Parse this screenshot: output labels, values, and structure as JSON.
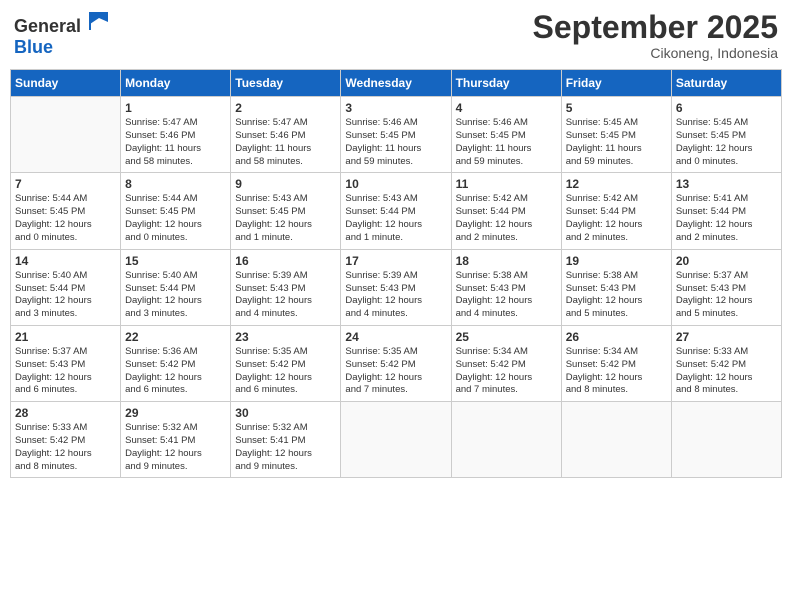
{
  "logo": {
    "general": "General",
    "blue": "Blue"
  },
  "header": {
    "month": "September 2025",
    "location": "Cikoneng, Indonesia"
  },
  "weekdays": [
    "Sunday",
    "Monday",
    "Tuesday",
    "Wednesday",
    "Thursday",
    "Friday",
    "Saturday"
  ],
  "weeks": [
    [
      {
        "day": "",
        "info": ""
      },
      {
        "day": "1",
        "info": "Sunrise: 5:47 AM\nSunset: 5:46 PM\nDaylight: 11 hours\nand 58 minutes."
      },
      {
        "day": "2",
        "info": "Sunrise: 5:47 AM\nSunset: 5:46 PM\nDaylight: 11 hours\nand 58 minutes."
      },
      {
        "day": "3",
        "info": "Sunrise: 5:46 AM\nSunset: 5:45 PM\nDaylight: 11 hours\nand 59 minutes."
      },
      {
        "day": "4",
        "info": "Sunrise: 5:46 AM\nSunset: 5:45 PM\nDaylight: 11 hours\nand 59 minutes."
      },
      {
        "day": "5",
        "info": "Sunrise: 5:45 AM\nSunset: 5:45 PM\nDaylight: 11 hours\nand 59 minutes."
      },
      {
        "day": "6",
        "info": "Sunrise: 5:45 AM\nSunset: 5:45 PM\nDaylight: 12 hours\nand 0 minutes."
      }
    ],
    [
      {
        "day": "7",
        "info": "Sunrise: 5:44 AM\nSunset: 5:45 PM\nDaylight: 12 hours\nand 0 minutes."
      },
      {
        "day": "8",
        "info": "Sunrise: 5:44 AM\nSunset: 5:45 PM\nDaylight: 12 hours\nand 0 minutes."
      },
      {
        "day": "9",
        "info": "Sunrise: 5:43 AM\nSunset: 5:45 PM\nDaylight: 12 hours\nand 1 minute."
      },
      {
        "day": "10",
        "info": "Sunrise: 5:43 AM\nSunset: 5:44 PM\nDaylight: 12 hours\nand 1 minute."
      },
      {
        "day": "11",
        "info": "Sunrise: 5:42 AM\nSunset: 5:44 PM\nDaylight: 12 hours\nand 2 minutes."
      },
      {
        "day": "12",
        "info": "Sunrise: 5:42 AM\nSunset: 5:44 PM\nDaylight: 12 hours\nand 2 minutes."
      },
      {
        "day": "13",
        "info": "Sunrise: 5:41 AM\nSunset: 5:44 PM\nDaylight: 12 hours\nand 2 minutes."
      }
    ],
    [
      {
        "day": "14",
        "info": "Sunrise: 5:40 AM\nSunset: 5:44 PM\nDaylight: 12 hours\nand 3 minutes."
      },
      {
        "day": "15",
        "info": "Sunrise: 5:40 AM\nSunset: 5:44 PM\nDaylight: 12 hours\nand 3 minutes."
      },
      {
        "day": "16",
        "info": "Sunrise: 5:39 AM\nSunset: 5:43 PM\nDaylight: 12 hours\nand 4 minutes."
      },
      {
        "day": "17",
        "info": "Sunrise: 5:39 AM\nSunset: 5:43 PM\nDaylight: 12 hours\nand 4 minutes."
      },
      {
        "day": "18",
        "info": "Sunrise: 5:38 AM\nSunset: 5:43 PM\nDaylight: 12 hours\nand 4 minutes."
      },
      {
        "day": "19",
        "info": "Sunrise: 5:38 AM\nSunset: 5:43 PM\nDaylight: 12 hours\nand 5 minutes."
      },
      {
        "day": "20",
        "info": "Sunrise: 5:37 AM\nSunset: 5:43 PM\nDaylight: 12 hours\nand 5 minutes."
      }
    ],
    [
      {
        "day": "21",
        "info": "Sunrise: 5:37 AM\nSunset: 5:43 PM\nDaylight: 12 hours\nand 6 minutes."
      },
      {
        "day": "22",
        "info": "Sunrise: 5:36 AM\nSunset: 5:42 PM\nDaylight: 12 hours\nand 6 minutes."
      },
      {
        "day": "23",
        "info": "Sunrise: 5:35 AM\nSunset: 5:42 PM\nDaylight: 12 hours\nand 6 minutes."
      },
      {
        "day": "24",
        "info": "Sunrise: 5:35 AM\nSunset: 5:42 PM\nDaylight: 12 hours\nand 7 minutes."
      },
      {
        "day": "25",
        "info": "Sunrise: 5:34 AM\nSunset: 5:42 PM\nDaylight: 12 hours\nand 7 minutes."
      },
      {
        "day": "26",
        "info": "Sunrise: 5:34 AM\nSunset: 5:42 PM\nDaylight: 12 hours\nand 8 minutes."
      },
      {
        "day": "27",
        "info": "Sunrise: 5:33 AM\nSunset: 5:42 PM\nDaylight: 12 hours\nand 8 minutes."
      }
    ],
    [
      {
        "day": "28",
        "info": "Sunrise: 5:33 AM\nSunset: 5:42 PM\nDaylight: 12 hours\nand 8 minutes."
      },
      {
        "day": "29",
        "info": "Sunrise: 5:32 AM\nSunset: 5:41 PM\nDaylight: 12 hours\nand 9 minutes."
      },
      {
        "day": "30",
        "info": "Sunrise: 5:32 AM\nSunset: 5:41 PM\nDaylight: 12 hours\nand 9 minutes."
      },
      {
        "day": "",
        "info": ""
      },
      {
        "day": "",
        "info": ""
      },
      {
        "day": "",
        "info": ""
      },
      {
        "day": "",
        "info": ""
      }
    ]
  ]
}
